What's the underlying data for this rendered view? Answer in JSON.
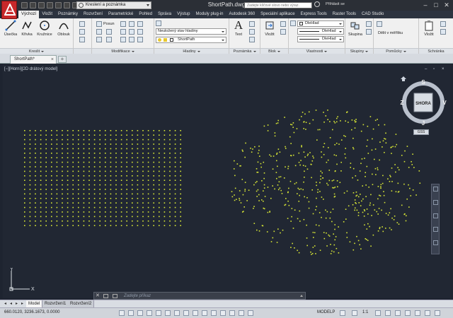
{
  "window": {
    "title": "ShortPath.dwg",
    "workspace": "Kreslení a poznámka",
    "search_placeholder": "Zadejte klíčové slovo nebo výraz.",
    "signin": "Přihlásit se",
    "minimize": "‒",
    "maximize": "□",
    "close": "✕"
  },
  "ribbon_tabs": [
    "Výchozí",
    "Vložit",
    "Poznámky",
    "Rozvržení",
    "Parametrické",
    "Pohled",
    "Správa",
    "Výstup",
    "Moduly plug-in",
    "Autodesk 360",
    "Speciální aplikace",
    "Express Tools",
    "Raster Tools",
    "CAD Studio"
  ],
  "ribbon": {
    "draw": {
      "label": "Kreslit",
      "line": "Úsečka",
      "polyline": "Křivka",
      "circle": "Kružnice",
      "arc": "Oblouk"
    },
    "modify": {
      "label": "Modifikace",
      "move": "Posun"
    },
    "layers": {
      "label": "Hladiny",
      "layer_state": "Neuložený stav hladiny",
      "current_layer": "ShortPath"
    },
    "annotation": {
      "label": "Poznámka",
      "text": "Text"
    },
    "block": {
      "label": "Blok",
      "insert": "Vložit"
    },
    "properties": {
      "label": "Vlastnosti",
      "color": "DleHlad",
      "linetype": "DleHlad",
      "lineweight": "DleHlad"
    },
    "groups": {
      "label": "Skupiny",
      "group": "Skupina"
    },
    "utilities": {
      "label": "Pomůcky",
      "measure": "Dělit v měřítku"
    },
    "clipboard": {
      "label": "Schránka",
      "paste": "Vložit"
    }
  },
  "file_tab": {
    "name": "ShortPath*",
    "close": "×",
    "new": "+"
  },
  "viewport": {
    "label": "[−][Horní][2D drátový model]",
    "minimize": "‒",
    "restore": "▫",
    "close": "×"
  },
  "viewcube": {
    "face": "SHORA",
    "north": "S",
    "south": "J",
    "east": "V",
    "west": "Z",
    "wcs": "GSS"
  },
  "ucs": {
    "x": "X",
    "y": "Y"
  },
  "colors": {
    "point": "#d7e635",
    "background": "#212733"
  },
  "command_line": {
    "close": "✕",
    "prompt": "Zadejte příkaz"
  },
  "layout_tabs": {
    "model": "Model",
    "layout1": "Rozvržení1",
    "layout2": "Rozvržení2"
  },
  "statusbar": {
    "coords": "660.0120, 3236.1673, 0.0000",
    "model": "MODELP",
    "scale": "1:1"
  }
}
